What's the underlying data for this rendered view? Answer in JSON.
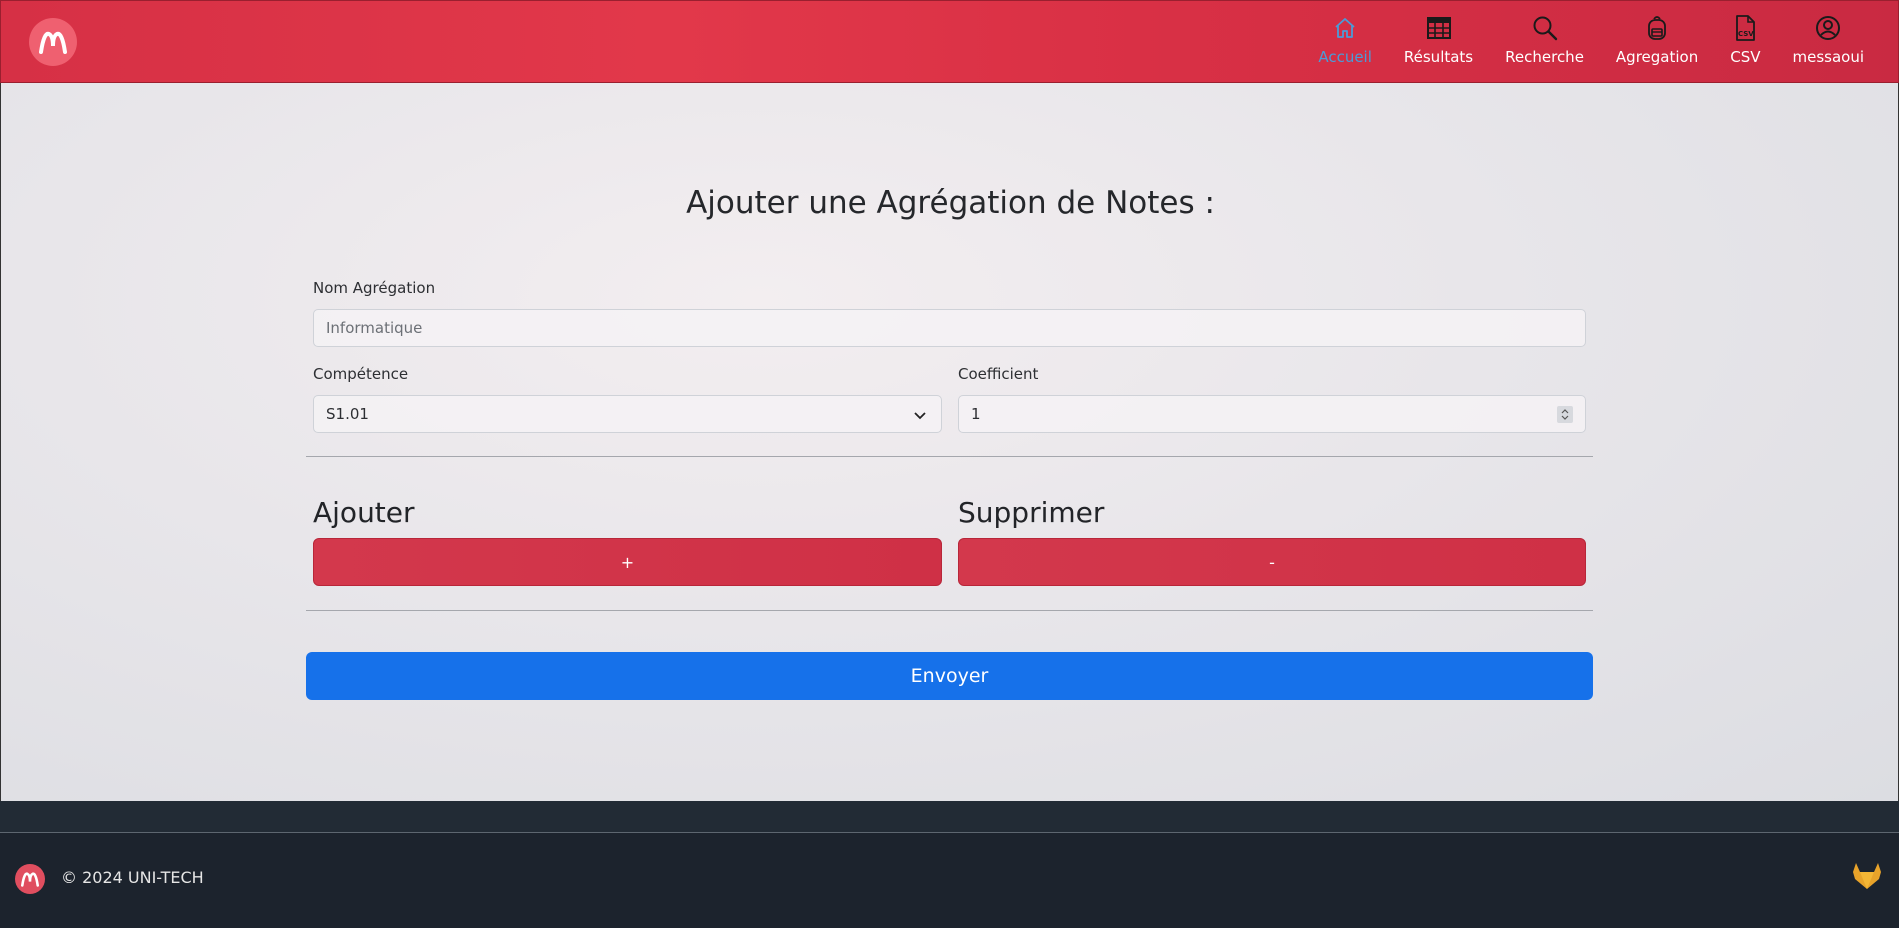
{
  "nav": {
    "items": [
      {
        "label": "Accueil",
        "icon": "house-icon",
        "active": true
      },
      {
        "label": "Résultats",
        "icon": "table-icon",
        "active": false
      },
      {
        "label": "Recherche",
        "icon": "search-icon",
        "active": false
      },
      {
        "label": "Agregation",
        "icon": "backpack-icon",
        "active": false
      },
      {
        "label": "CSV",
        "icon": "csv-file-icon",
        "active": false
      },
      {
        "label": "messaoui",
        "icon": "user-icon",
        "active": false
      }
    ]
  },
  "form": {
    "title": "Ajouter une Agrégation de Notes :",
    "nom_label": "Nom Agrégation",
    "nom_placeholder": "Informatique",
    "competence_label": "Compétence",
    "competence_value": "S1.01",
    "coefficient_label": "Coefficient",
    "coefficient_value": "1",
    "ajouter_title": "Ajouter",
    "ajouter_button": "+",
    "supprimer_title": "Supprimer",
    "supprimer_button": "-",
    "submit_label": "Envoyer"
  },
  "footer": {
    "copyright": "© 2024 UNI-TECH"
  },
  "colors": {
    "navbar": "#d63045",
    "accent_active": "#4a9bd8",
    "danger": "#d3384c",
    "primary": "#1671ea",
    "footer": "#1c232d"
  }
}
